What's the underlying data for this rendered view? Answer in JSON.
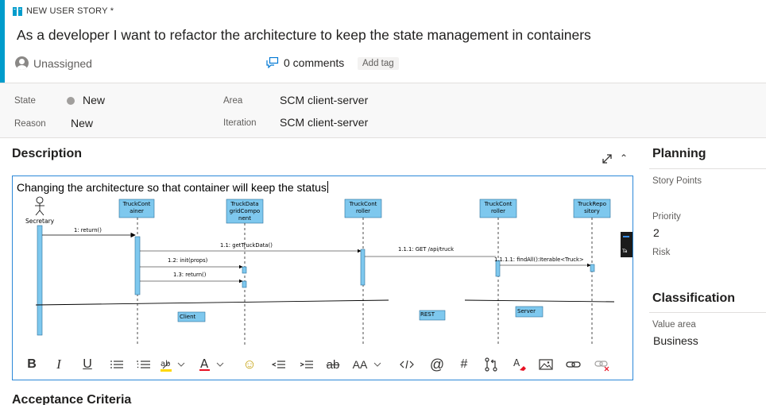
{
  "work_item": {
    "type_label": "NEW USER STORY *",
    "title": "As a developer I want to refactor the architecture to keep the state management in containers",
    "assignee": "Unassigned",
    "comments": "0 comments",
    "add_tag": "Add tag"
  },
  "fields": {
    "state_label": "State",
    "state_value": "New",
    "reason_label": "Reason",
    "reason_value": "New",
    "area_label": "Area",
    "area_value": "SCM client-server",
    "iteration_label": "Iteration",
    "iteration_value": "SCM client-server"
  },
  "description": {
    "heading": "Description",
    "text": "Changing the architecture so that container will keep the status",
    "diagram": {
      "actor": "Secretary",
      "lifelines": [
        "TruckCont\nainer",
        "TruckData\ngridCompo\nnent",
        "TruckCont\nroller",
        "TruckCont\nroller",
        "TruckRepo\nsitory"
      ],
      "messages": [
        "1: return()",
        "1.1: getTruckData()",
        "1.2: init(props)",
        "1.3: return()",
        "1.1.1: GET /api/truck",
        "1.1.1.1: findAll():Iterable<Truck>"
      ],
      "boundaries": [
        "Client",
        "REST",
        "Server"
      ],
      "tab_fragment": "Ta"
    }
  },
  "toolbar": {
    "bold": "B",
    "italic": "I",
    "underline": "U",
    "font_size": "AA"
  },
  "acceptance": {
    "heading": "Acceptance Criteria"
  },
  "planning": {
    "heading": "Planning",
    "story_points_label": "Story Points",
    "priority_label": "Priority",
    "priority_value": "2",
    "risk_label": "Risk"
  },
  "classification": {
    "heading": "Classification",
    "value_area_label": "Value area",
    "value_area_value": "Business"
  },
  "colors": {
    "accent": "#009ccc",
    "editor_border": "#2b88d8",
    "lifeline_box": "#7ec8ee"
  }
}
